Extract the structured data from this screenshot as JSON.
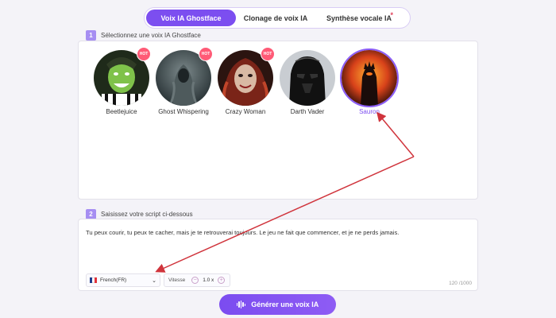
{
  "tabs": [
    {
      "label": "Voix IA Ghostface",
      "active": true
    },
    {
      "label": "Clonage de voix IA",
      "active": false
    },
    {
      "label": "Synthèse vocale IA",
      "active": false,
      "marker": "*"
    }
  ],
  "step1": {
    "number": "1",
    "label": "Sélectionnez une voix IA Ghostface"
  },
  "voices": [
    {
      "name": "Beetlejuice",
      "badge": "HOT",
      "icon": "beetlejuice-avatar"
    },
    {
      "name": "Ghost Whispering",
      "badge": "HOT",
      "icon": "ghost-avatar"
    },
    {
      "name": "Crazy Woman",
      "badge": "HOT",
      "icon": "crazy-woman-avatar"
    },
    {
      "name": "Darth Vader",
      "badge": "",
      "icon": "darth-vader-avatar"
    },
    {
      "name": "Sauron",
      "badge": "",
      "icon": "sauron-avatar",
      "selected": true
    }
  ],
  "step2": {
    "number": "2",
    "label": "Saisissez votre script ci-dessous"
  },
  "script": {
    "text": "Tu peux courir, tu peux te cacher, mais je te retrouverai toujours. Le jeu ne fait que commencer, et je ne perds jamais.",
    "counter": "120 /1000"
  },
  "language": {
    "value": "French(FR)",
    "flag_colors": [
      "#1f3b8c",
      "#ffffff",
      "#e2323b"
    ]
  },
  "speed": {
    "label": "Vitesse",
    "value": "1.0 x",
    "minus": "−",
    "plus": "+"
  },
  "generate_button": {
    "label": "Générer une voix IA"
  },
  "colors": {
    "accent": "#7c4ef0",
    "arrow": "#d0343c",
    "hot": "#ff5a76"
  }
}
